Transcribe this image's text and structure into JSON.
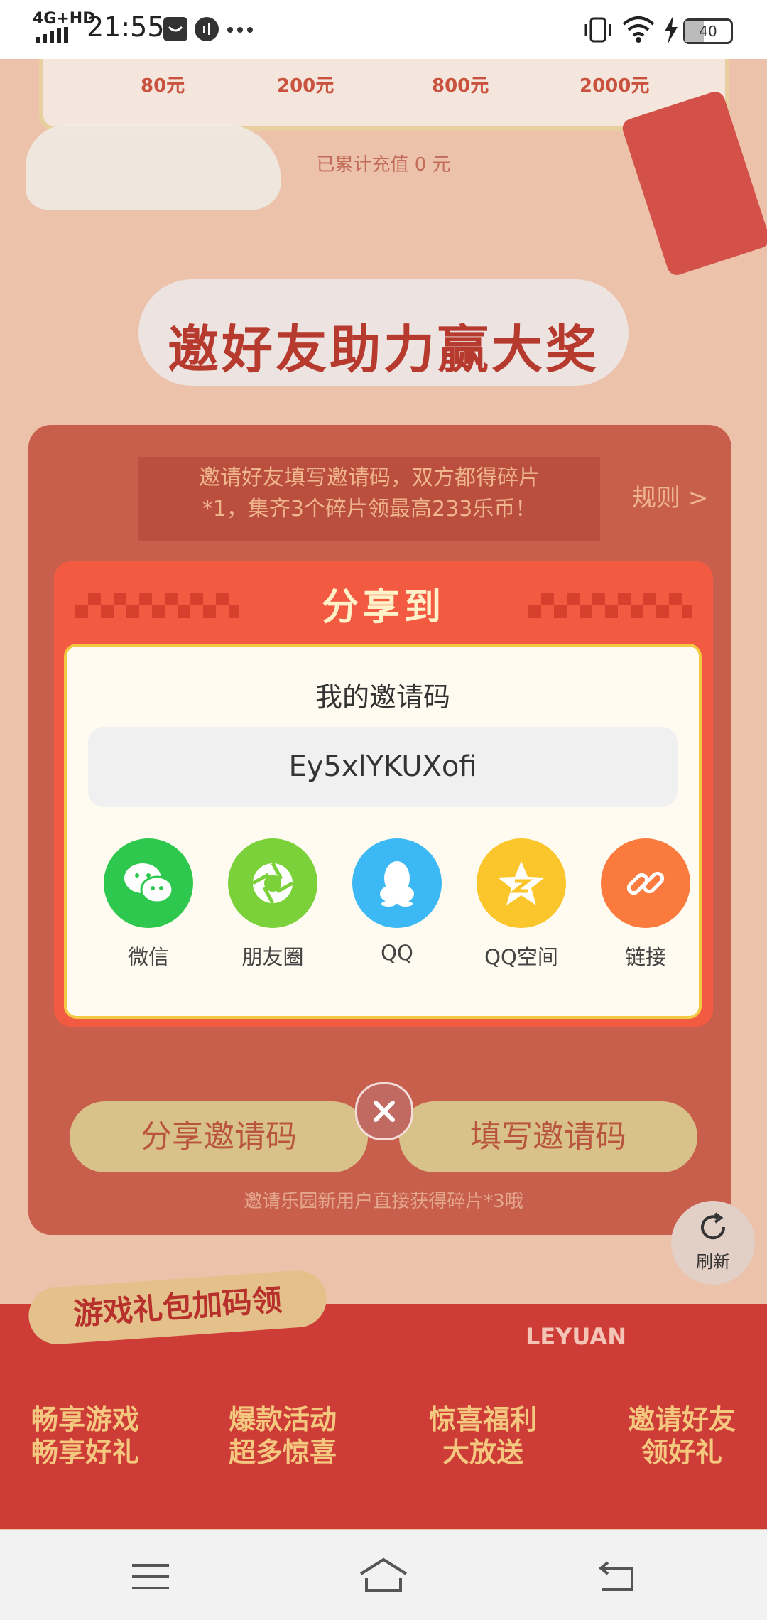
{
  "status_bar": {
    "network": "4G+HD",
    "time": "21:55",
    "battery": "40"
  },
  "top_card": {
    "amounts": [
      "80元",
      "200元",
      "800元",
      "2000元"
    ],
    "accumulated": "已累计充值 0 元"
  },
  "section": {
    "title": "邀好友助力赢大奖",
    "invite_text_line1": "邀请好友填写邀请码，双方都得碎片",
    "invite_text_line2": "*1，集齐3个碎片领最高233乐币！",
    "rules_label": "规则 >",
    "share_code_button": "分享邀请码",
    "fill_code_button": "填写邀请码",
    "note": "邀请乐园新用户直接获得碎片*3哦"
  },
  "refresh": {
    "label": "刷新"
  },
  "banner": {
    "title": "游戏礼包加码领",
    "brand": "LEYUAN",
    "items": [
      {
        "line1": "畅享游戏",
        "line2": "畅享好礼"
      },
      {
        "line1": "爆款活动",
        "line2": "超多惊喜"
      },
      {
        "line1": "惊喜福利",
        "line2": "大放送"
      },
      {
        "line1": "邀请好友",
        "line2": "领好礼"
      }
    ]
  },
  "dialog": {
    "title": "分享到",
    "code_label": "我的邀请码",
    "code_value": "Ey5xlYKUXofi",
    "targets": [
      {
        "label": "微信",
        "color": "#2dc84d",
        "icon": "wechat-icon"
      },
      {
        "label": "朋友圈",
        "color": "#7bd13a",
        "icon": "moments-icon"
      },
      {
        "label": "QQ",
        "color": "#3cb8f4",
        "icon": "qq-icon"
      },
      {
        "label": "QQ空间",
        "color": "#fbc62c",
        "icon": "qzone-icon"
      },
      {
        "label": "链接",
        "color": "#fb7a3e",
        "icon": "link-icon"
      }
    ]
  },
  "colors": {
    "dialog_red": "#f25a41",
    "dialog_border": "#f3c842",
    "page_red": "#c85f4c"
  }
}
